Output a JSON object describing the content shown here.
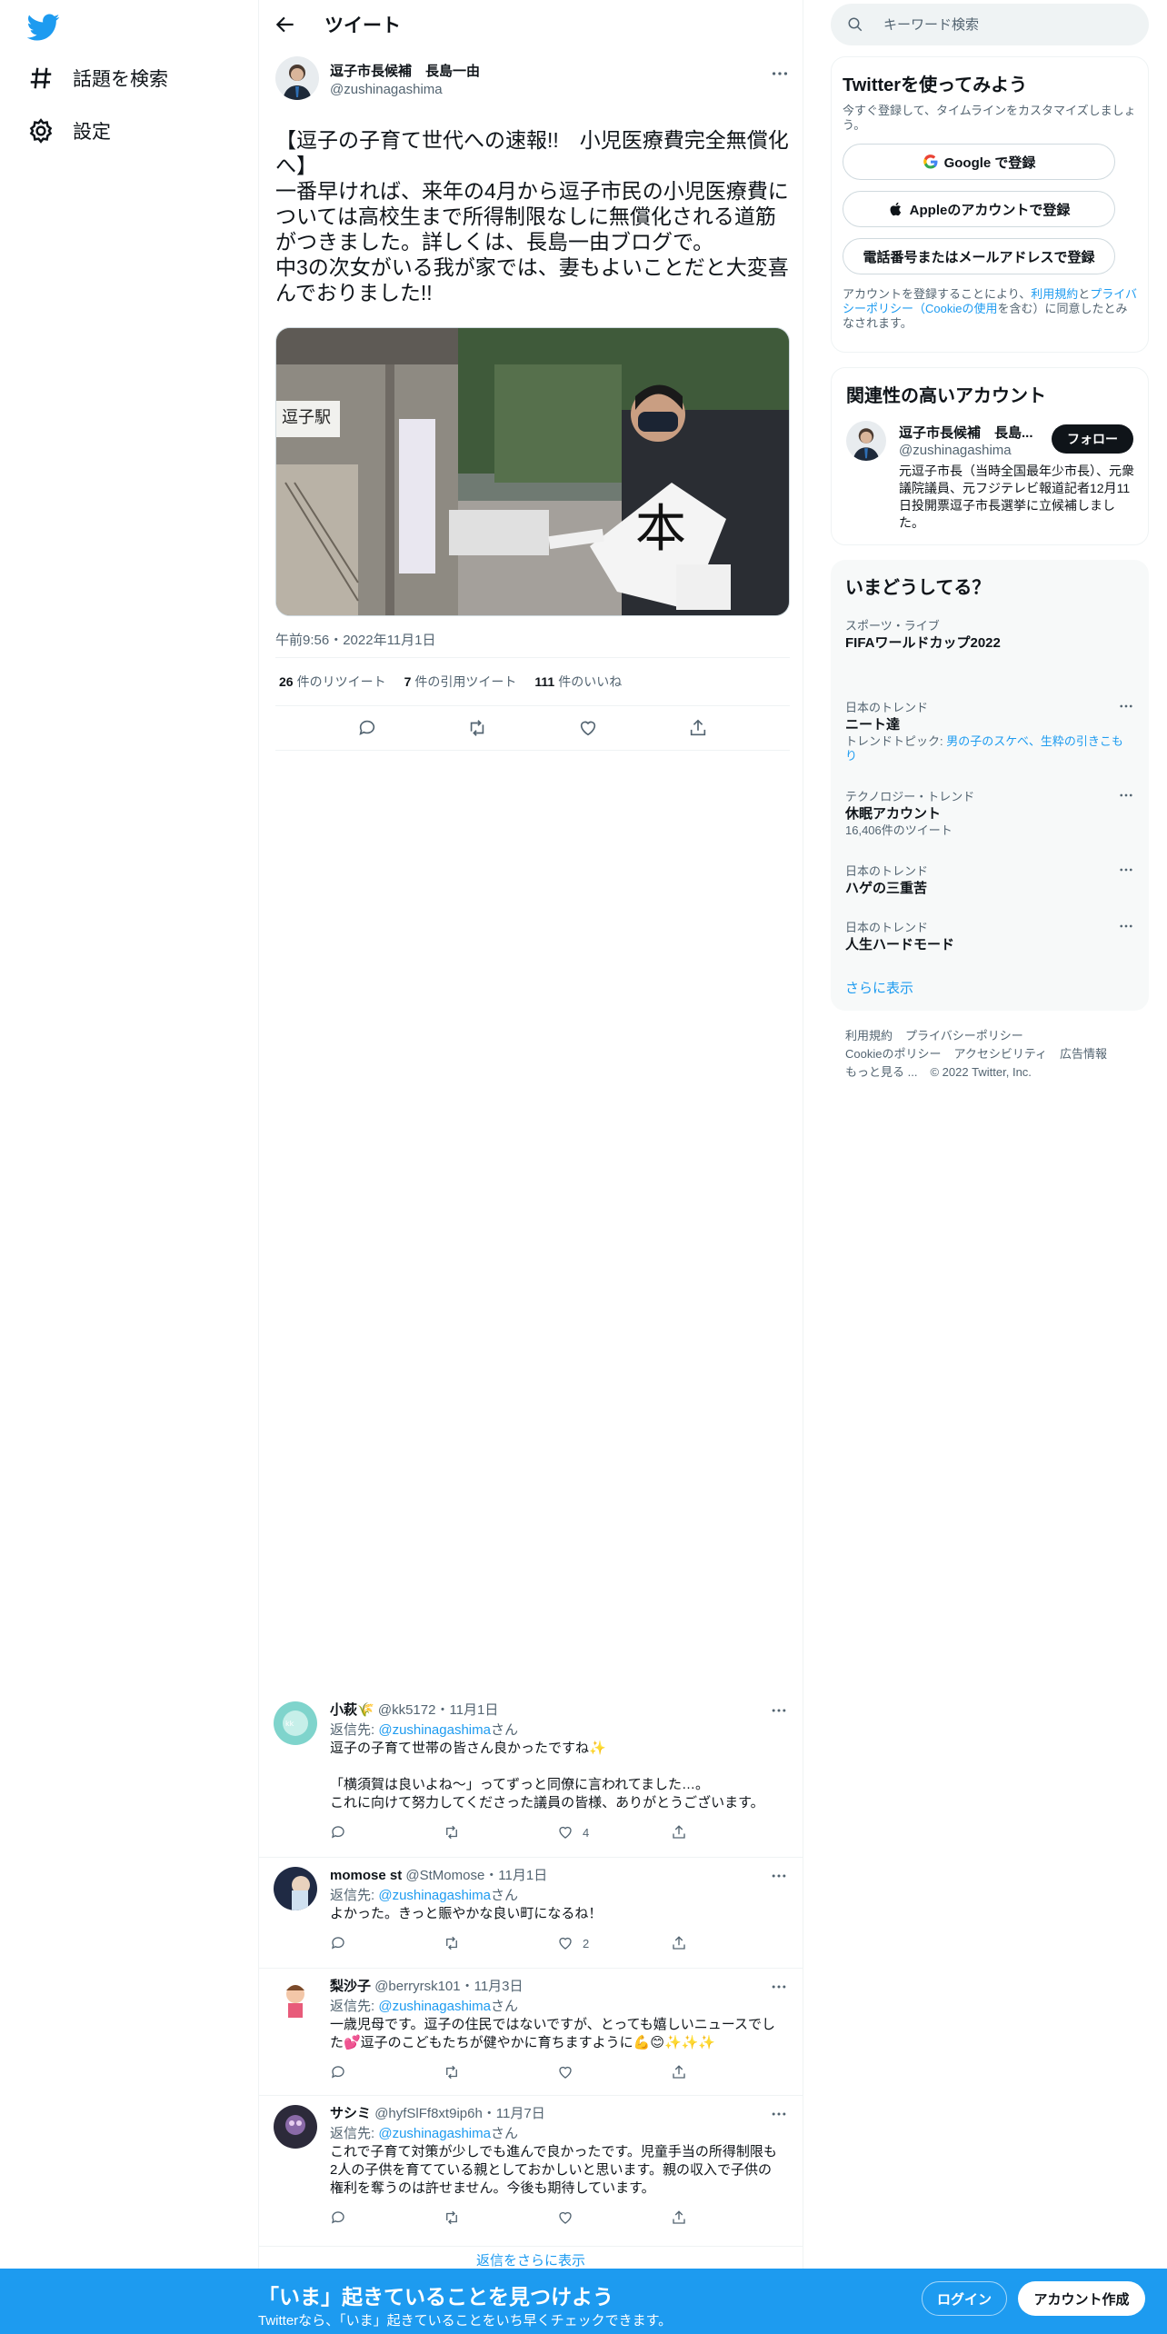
{
  "nav": {
    "explore_label": "話題を検索",
    "settings_label": "設定"
  },
  "header": {
    "title": "ツイート"
  },
  "tweet": {
    "author_name": "逗子市長候補　長島一由",
    "author_handle": "@zushinagashima",
    "text": "【逗子の子育て世代への速報!!　小児医療費完全無償化へ】\n一番早ければ、来年の4月から逗子市民の小児医療費については高校生まで所得制限なしに無償化される道筋がつきました。詳しくは、長島一由ブログで。\n中3の次女がいる我が家では、妻もよいことだと大変喜んでおりました!!",
    "timestamp": "午前9:56・2022年11月1日",
    "retweets": "26",
    "retweets_label": "件のリツイート",
    "quotes": "7",
    "quotes_label": "件の引用ツイート",
    "likes": "111",
    "likes_label": "件のいいね"
  },
  "replies": [
    {
      "name": "小萩🌾",
      "meta": "@kk5172・11月1日",
      "reply_to_prefix": "返信先: ",
      "reply_to_handle": "@zushinagashima",
      "reply_to_suffix": "さん",
      "text": "逗子の子育て世帯の皆さん良かったですね✨\n\n「横須賀は良いよね〜」ってずっと同僚に言われてました…。\nこれに向けて努力してくださった議員の皆様、ありがとうございます。",
      "likes": "4"
    },
    {
      "name": "momose st",
      "meta": "@StMomose・11月1日",
      "reply_to_prefix": "返信先: ",
      "reply_to_handle": "@zushinagashima",
      "reply_to_suffix": "さん",
      "text": "よかった。きっと賑やかな良い町になるね！",
      "likes": "2"
    },
    {
      "name": "梨沙子",
      "meta": "@berryrsk101・11月3日",
      "reply_to_prefix": "返信先: ",
      "reply_to_handle": "@zushinagashima",
      "reply_to_suffix": "さん",
      "text": "一歳児母です。逗子の住民ではないですが、とっても嬉しいニュースでした💕逗子のこどもたちが健やかに育ちますように💪😊✨✨✨",
      "likes": ""
    },
    {
      "name": "サシミ",
      "meta": "@hyfSlFf8xt9ip6h・11月7日",
      "reply_to_prefix": "返信先: ",
      "reply_to_handle": "@zushinagashima",
      "reply_to_suffix": "さん",
      "text": "これで子育て対策が少しでも進んで良かったです。児童手当の所得制限も2人の子供を育てている親としておかしいと思います。親の収入で子供の権利を奪うのは許せません。今後も期待しています。",
      "likes": ""
    }
  ],
  "show_more_replies": "返信をさらに表示",
  "sidebar": {
    "search_placeholder": "キーワード検索",
    "signup": {
      "title": "Twitterを使ってみよう",
      "subtitle": "今すぐ登録して、タイムラインをカスタマイズしましょう。",
      "google_label": "Google で登録",
      "apple_label": "Appleのアカウントで登録",
      "phone_label": "電話番号またはメールアドレスで登録",
      "terms_prefix": "アカウントを登録することにより、",
      "terms_link1": "利用規約",
      "terms_mid": "と",
      "terms_link2": "プライバシーポリシー（Cookieの使用",
      "terms_suffix": "を含む）に同意したとみなされます。"
    },
    "related": {
      "title": "関連性の高いアカウント",
      "name": "逗子市長候補　長島...",
      "handle": "@zushinagashima",
      "follow_label": "フォロー",
      "bio": "元逗子市長（当時全国最年少市長）、元衆議院議員、元フジテレビ報道記者12月11日投開票逗子市長選挙に立候補しました。"
    },
    "trends": {
      "title": "いまどうしてる？",
      "items": [
        {
          "category": "スポーツ・ライブ",
          "name": "FIFAワールドカップ2022",
          "extra": ""
        },
        {
          "category": "日本のトレンド",
          "name": "ニート達",
          "extra_prefix": "トレンドトピック: ",
          "extra": "男の子のスケベ、生粋の引きこもり"
        },
        {
          "category": "テクノロジー・トレンド",
          "name": "休眠アカウント",
          "extra": "16,406件のツイート"
        },
        {
          "category": "日本のトレンド",
          "name": "ハゲの三重苦",
          "extra": ""
        },
        {
          "category": "日本のトレンド",
          "name": "人生ハードモード",
          "extra": ""
        }
      ],
      "show_more": "さらに表示"
    },
    "footer": {
      "terms": "利用規約",
      "privacy": "プライバシーポリシー",
      "cookie": "Cookieのポリシー",
      "accessibility": "アクセシビリティ",
      "ads": "広告情報",
      "more": "もっと見る ...",
      "copyright": "© 2022 Twitter, Inc."
    }
  },
  "bottombar": {
    "title": "「いま」起きていることを見つけよう",
    "subtitle": "Twitterなら、「いま」起きていることをいち早くチェックできます。",
    "login_label": "ログイン",
    "signup_label": "アカウント作成"
  },
  "colors": {
    "brand": "#1d9bf0",
    "text": "#0f1419",
    "muted": "#536471"
  }
}
